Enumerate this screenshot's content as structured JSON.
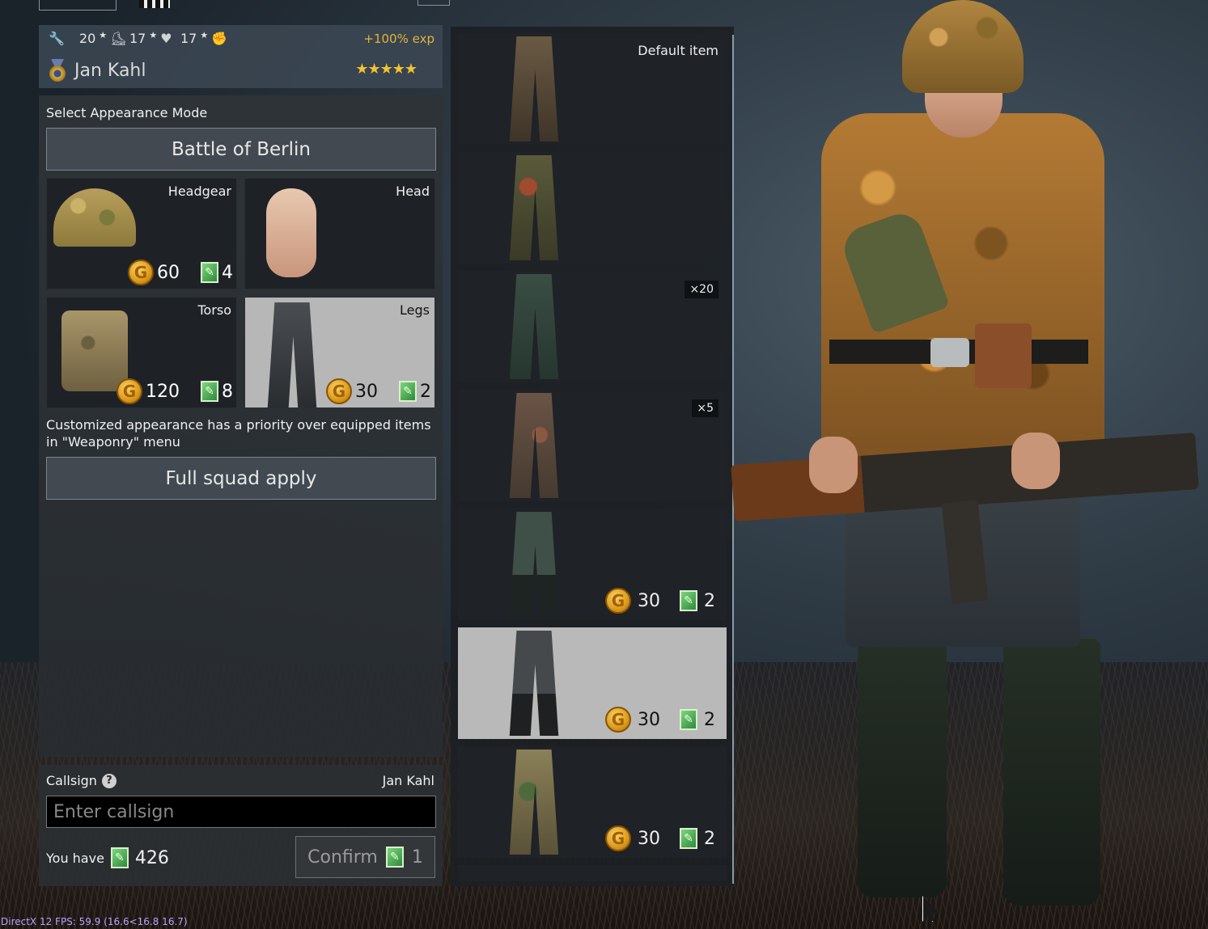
{
  "stats": {
    "s1": "20",
    "s2": "17",
    "s3": "17",
    "exp_bonus": "+100% exp",
    "soldier_name": "Jan Kahl",
    "stars": "★★★★★"
  },
  "appearance": {
    "mode_label": "Select Appearance Mode",
    "mode_value": "Battle of Berlin",
    "note": "Customized appearance has a priority over equipped items in \"Weaponry\" menu",
    "full_squad_apply": "Full squad apply",
    "slots": [
      {
        "label": "Headgear",
        "gold": "60",
        "tickets": "4"
      },
      {
        "label": "Head"
      },
      {
        "label": "Torso",
        "gold": "120",
        "tickets": "8"
      },
      {
        "label": "Legs",
        "gold": "30",
        "tickets": "2"
      }
    ]
  },
  "items": [
    {
      "label": "Default item"
    },
    {},
    {
      "badge": "×20"
    },
    {
      "badge": "×5"
    },
    {
      "gold": "30",
      "tickets": "2"
    },
    {
      "gold": "30",
      "tickets": "2"
    },
    {
      "gold": "30",
      "tickets": "2"
    }
  ],
  "callsign": {
    "label": "Callsign",
    "help": "?",
    "current_name": "Jan Kahl",
    "placeholder": "Enter callsign",
    "you_have_label": "You have",
    "balance": "426",
    "confirm_label": "Confirm",
    "confirm_cost": "1"
  },
  "icons": {
    "coin": "G",
    "ticket": "✎"
  },
  "fps_overlay": "DirectX 12 FPS: 59.9 (16.6<16.8 16.7)"
}
